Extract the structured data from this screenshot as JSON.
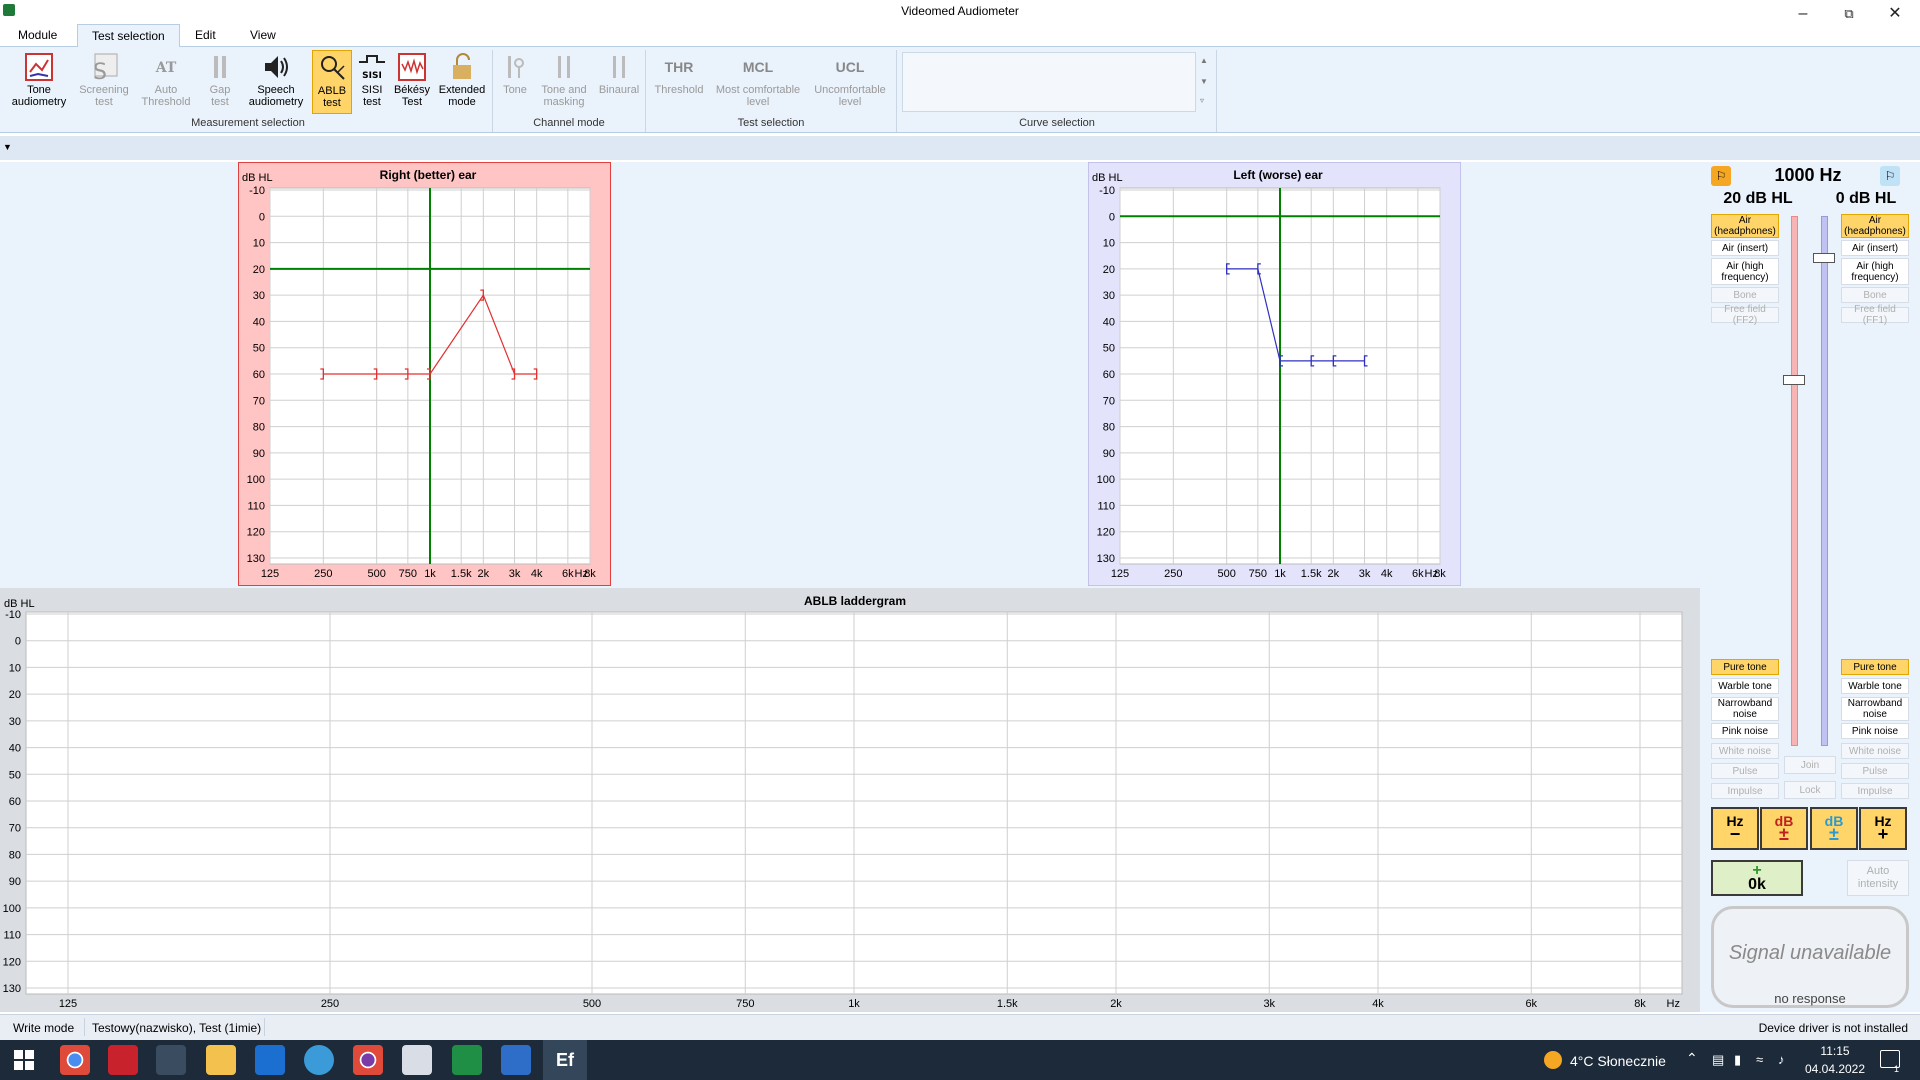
{
  "window": {
    "title": "Videomed Audiometer"
  },
  "menu": {
    "tabs": [
      "Module",
      "Test selection",
      "Edit",
      "View"
    ]
  },
  "ribbon": {
    "buttons": [
      {
        "label": "Tone audiometry"
      },
      {
        "label": "Screening test"
      },
      {
        "label": "Auto Threshold"
      },
      {
        "label": "Gap test"
      },
      {
        "label": "Speech audiometry"
      },
      {
        "label": "ABLB test"
      },
      {
        "label": "SISI test"
      },
      {
        "label": "Békésy Test"
      },
      {
        "label": "Extended mode"
      },
      {
        "label": "Tone"
      },
      {
        "label": "Tone and masking"
      },
      {
        "label": "Binaural"
      },
      {
        "label": "Threshold",
        "abbr": "THR"
      },
      {
        "label": "Most comfortable level",
        "abbr": "MCL"
      },
      {
        "label": "Uncomfortable level",
        "abbr": "UCL"
      }
    ],
    "groups": [
      "Measurement selection",
      "Channel mode",
      "Test selection",
      "Curve selection"
    ],
    "sisi_icon_text": "SISI",
    "at_icon_text": "AT"
  },
  "colors": {
    "right": "#e03030",
    "left": "#3030c0",
    "green": "#008000",
    "highlight": "#ffd56a"
  },
  "chart_data": [
    {
      "type": "line",
      "title": "Right (better) ear",
      "ylabel": "dB HL",
      "xlabel_unit": "Hz",
      "x_ticks": [
        "125",
        "250",
        "500",
        "750",
        "1k",
        "1.5k",
        "2k",
        "3k",
        "4k",
        "6k",
        "8k"
      ],
      "y_ticks": [
        -10,
        0,
        10,
        20,
        30,
        40,
        50,
        60,
        70,
        80,
        90,
        100,
        110,
        120,
        130
      ],
      "ylim": [
        -10,
        130
      ],
      "cursor": {
        "x": "1k",
        "y": 20
      },
      "series": [
        {
          "x": [
            "250",
            "500",
            "750",
            "1k",
            "2k",
            "3k",
            "4k"
          ],
          "y": [
            60,
            60,
            60,
            60,
            30,
            60,
            60
          ]
        }
      ]
    },
    {
      "type": "line",
      "title": "Left (worse) ear",
      "ylabel": "dB HL",
      "xlabel_unit": "Hz",
      "x_ticks": [
        "125",
        "250",
        "500",
        "750",
        "1k",
        "1.5k",
        "2k",
        "3k",
        "4k",
        "6k",
        "8k"
      ],
      "y_ticks": [
        -10,
        0,
        10,
        20,
        30,
        40,
        50,
        60,
        70,
        80,
        90,
        100,
        110,
        120,
        130
      ],
      "ylim": [
        -10,
        130
      ],
      "cursor": {
        "x": "1k",
        "y": 0
      },
      "series": [
        {
          "x": [
            "500",
            "750",
            "1k",
            "1.5k",
            "2k",
            "3k"
          ],
          "y": [
            20,
            20,
            55,
            55,
            55,
            55
          ]
        }
      ]
    },
    {
      "type": "line",
      "title": "ABLB laddergram",
      "ylabel": "dB HL",
      "xlabel_unit": "Hz",
      "x_ticks": [
        "125",
        "250",
        "500",
        "750",
        "1k",
        "1.5k",
        "2k",
        "3k",
        "4k",
        "6k",
        "8k"
      ],
      "y_ticks": [
        -10,
        0,
        10,
        20,
        30,
        40,
        50,
        60,
        70,
        80,
        90,
        100,
        110,
        120,
        130
      ],
      "ylim": [
        -10,
        130
      ],
      "series": []
    }
  ],
  "side": {
    "freq": "1000 Hz",
    "right_level": "20 dB HL",
    "left_level": "0 dB HL",
    "right_level_frac": 0.3,
    "left_level_frac": 0.07,
    "transducers_right": [
      "Air (headphones)",
      "Air (insert)",
      "Air (high frequency)",
      "Bone",
      "Free field (FF2)"
    ],
    "transducers_left": [
      "Air (headphones)",
      "Air (insert)",
      "Air (high frequency)",
      "Bone",
      "Free field (FF1)"
    ],
    "stimuli_right": [
      "Pure tone",
      "Warble tone",
      "Narrowband noise",
      "Pink noise",
      "White noise",
      "Pulse",
      "Impulse"
    ],
    "stimuli_left": [
      "Pure tone",
      "Warble tone",
      "Narrowband noise",
      "Pink noise",
      "White noise",
      "Pulse",
      "Impulse"
    ],
    "join": "Join",
    "lock": "Lock",
    "hz": "Hz",
    "db": "dB",
    "ok": "0k",
    "auto_intensity": "Auto intensity",
    "signal": "Signal unavailable",
    "response": "no response"
  },
  "status": {
    "mode": "Write mode",
    "patient": "Testowy(nazwisko), Test (1imie)",
    "driver": "Device driver is not installed"
  },
  "taskbar": {
    "weather": "4°C Słonecznie",
    "time": "11:15",
    "date": "04.04.2022",
    "notif": "1"
  }
}
